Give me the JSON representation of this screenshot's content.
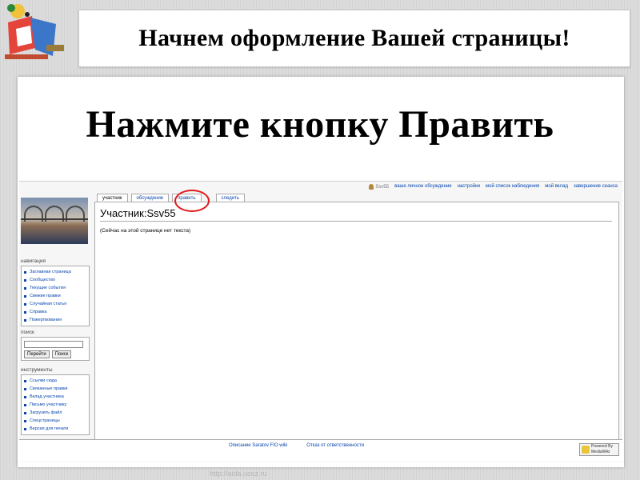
{
  "slide": {
    "title": "Начнем оформление Вашей страницы!",
    "headline": "Нажмите кнопку Править",
    "watermark": "http://aida.ucoz.ru"
  },
  "wiki": {
    "personal_bar": {
      "user": "Ssv55",
      "links": [
        "ваше личное обсуждение",
        "настройки",
        "мой список наблюдения",
        "мой вклад",
        "завершение сеанса"
      ]
    },
    "tabs": [
      {
        "label": "участник",
        "selected": true
      },
      {
        "label": "обсуждение",
        "selected": false
      },
      {
        "label": "править",
        "selected": false
      },
      {
        "label": "следить",
        "selected": false
      }
    ],
    "page_title": "Участник:Ssv55",
    "page_note": "(Сейчас на этой странице нет текста)",
    "navigation": {
      "title": "навигация",
      "items": [
        "Заглавная страница",
        "Сообщество",
        "Текущие события",
        "Свежие правки",
        "Случайная статья",
        "Справка",
        "Пожертвования"
      ]
    },
    "search": {
      "title": "поиск",
      "go_label": "Перейти",
      "search_label": "Поиск"
    },
    "tools": {
      "title": "инструменты",
      "items": [
        "Ссылки сюда",
        "Связанные правки",
        "Вклад участника",
        "Письмо участнику",
        "Загрузить файл",
        "Спецстраницы",
        "Версия для печати"
      ]
    },
    "footer": {
      "links": [
        "Описание Saratov FIO wiki",
        "Отказ от ответственности"
      ],
      "powered": [
        "Powered By",
        "MediaWiki"
      ]
    }
  },
  "colors": {
    "link": "#0645ad",
    "highlight": "#e01818"
  },
  "icons": [
    "logo-icon",
    "user-icon",
    "mediawiki-icon"
  ]
}
